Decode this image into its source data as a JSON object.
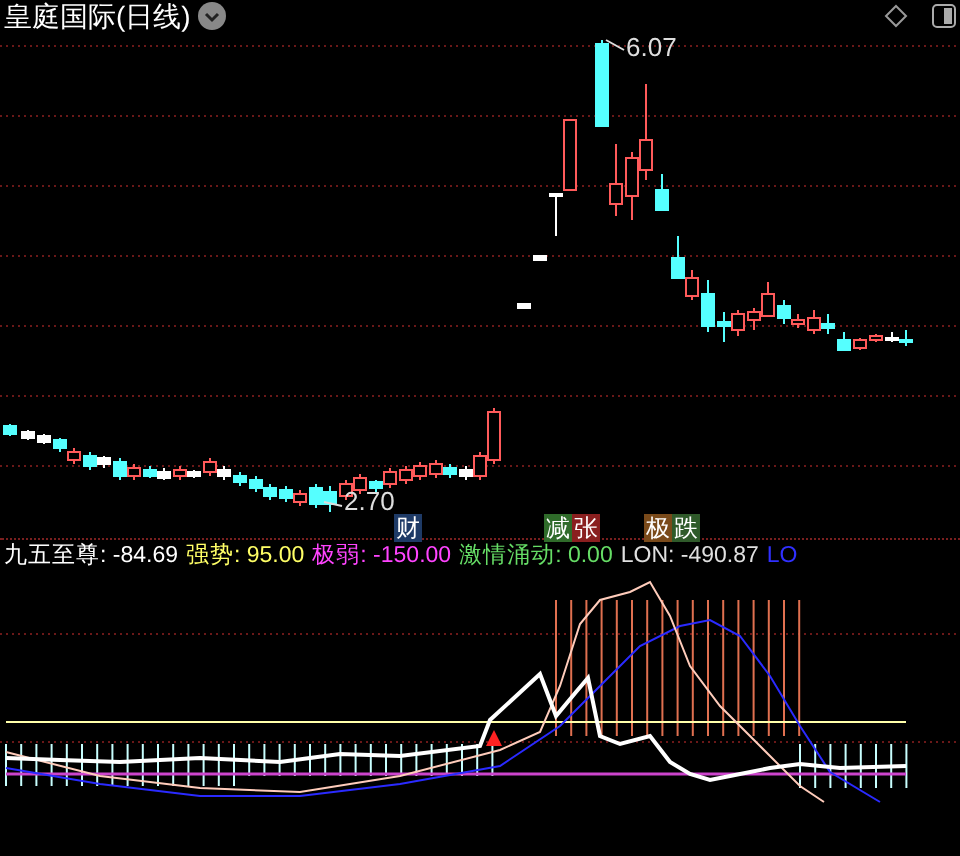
{
  "title": "皇庭国际(日线)",
  "price_high": "6.07",
  "price_low": "2.70",
  "signals": [
    {
      "text": "财",
      "color": "#1e3a66"
    },
    {
      "text": "减",
      "color": "#2f6b2a"
    },
    {
      "text": "张",
      "color": "#8a1f1f"
    },
    {
      "text": "极",
      "color": "#7a4a1a"
    },
    {
      "text": "跌",
      "color": "#2f5a2a"
    }
  ],
  "legend": [
    {
      "text": "九五至尊: -84.69",
      "color": "#ffffff"
    },
    {
      "text": "强势: 95.00",
      "color": "#ffff66"
    },
    {
      "text": "极弱: -150.00",
      "color": "#ff44ff"
    },
    {
      "text": "激情涌动: 0.00",
      "color": "#66dd66"
    },
    {
      "text": "LON: -490.87",
      "color": "#e0e0e0"
    },
    {
      "text": "LO",
      "color": "#3030ff"
    }
  ]
}
